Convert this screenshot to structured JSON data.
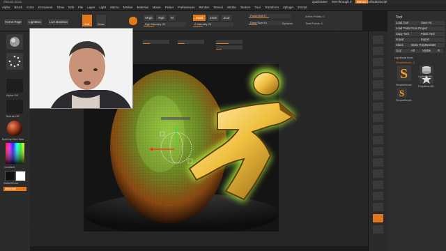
{
  "window": {
    "title": "ZBrush 2018"
  },
  "menu": [
    "Alpha",
    "Brush",
    "Color",
    "Document",
    "Draw",
    "Edit",
    "File",
    "Layer",
    "Light",
    "Macro",
    "Marker",
    "Material",
    "Movie",
    "Picker",
    "Preferences",
    "Render",
    "Stencil",
    "Stroke",
    "Texture",
    "Tool",
    "Transform",
    "Zplugin",
    "Zscript"
  ],
  "topright": {
    "quicksave": "QuickSave",
    "seethrough": "See-through 0",
    "menus": "Menus",
    "script": "DefaultZScript"
  },
  "toolbar": {
    "home": "Home Page",
    "lightbox": "LightBox",
    "liveboolean": "Live Boolean",
    "edit": "Edit",
    "draw": "Draw",
    "mrgb": "Mrgb",
    "rgb": "Rgb",
    "m": "M",
    "zadd": "Zadd",
    "zsub": "Zsub",
    "zcut": "Zcut",
    "rgb_intensity": "Rgb Intensity 25",
    "z_intensity": "Z Intensity 25",
    "focal_shift": "Focal Shift 0",
    "draw_size": "Draw Size 64",
    "dynamic": "Dynamic",
    "active_points": "Active Points: 0",
    "total_points": "Total Points: 0"
  },
  "leftshelf": {
    "alpha": "Alpha Off",
    "texture": "Texture Off",
    "material": "MatCap Red Wax",
    "gradient": "Gradient",
    "switchcolor": "SwitchColor",
    "alternate": "Alternate"
  },
  "tooltray": {
    "title": "Tool",
    "load": "Load Tool",
    "saveas": "Save As",
    "loadproject": "Load Tools From Project",
    "copy": "Copy Tool",
    "paste": "Paste Tool",
    "import": "Import",
    "export": "Export",
    "clone": "Clone",
    "makepoly": "Make PolyMesh3D",
    "goz": "GoZ",
    "all": "All",
    "visible": "Visible",
    "r": "R",
    "lightbox_tools": "Lightbox▸Tools",
    "current": "SimpleBrush. 2",
    "items": [
      "SimpleBrush",
      "Cylinder3D",
      "PolyMesh3D",
      "SimpleBrush"
    ]
  },
  "colors": {
    "accent": "#e0791d",
    "logo": "#f0c040",
    "glow": "#b6ff3c"
  }
}
